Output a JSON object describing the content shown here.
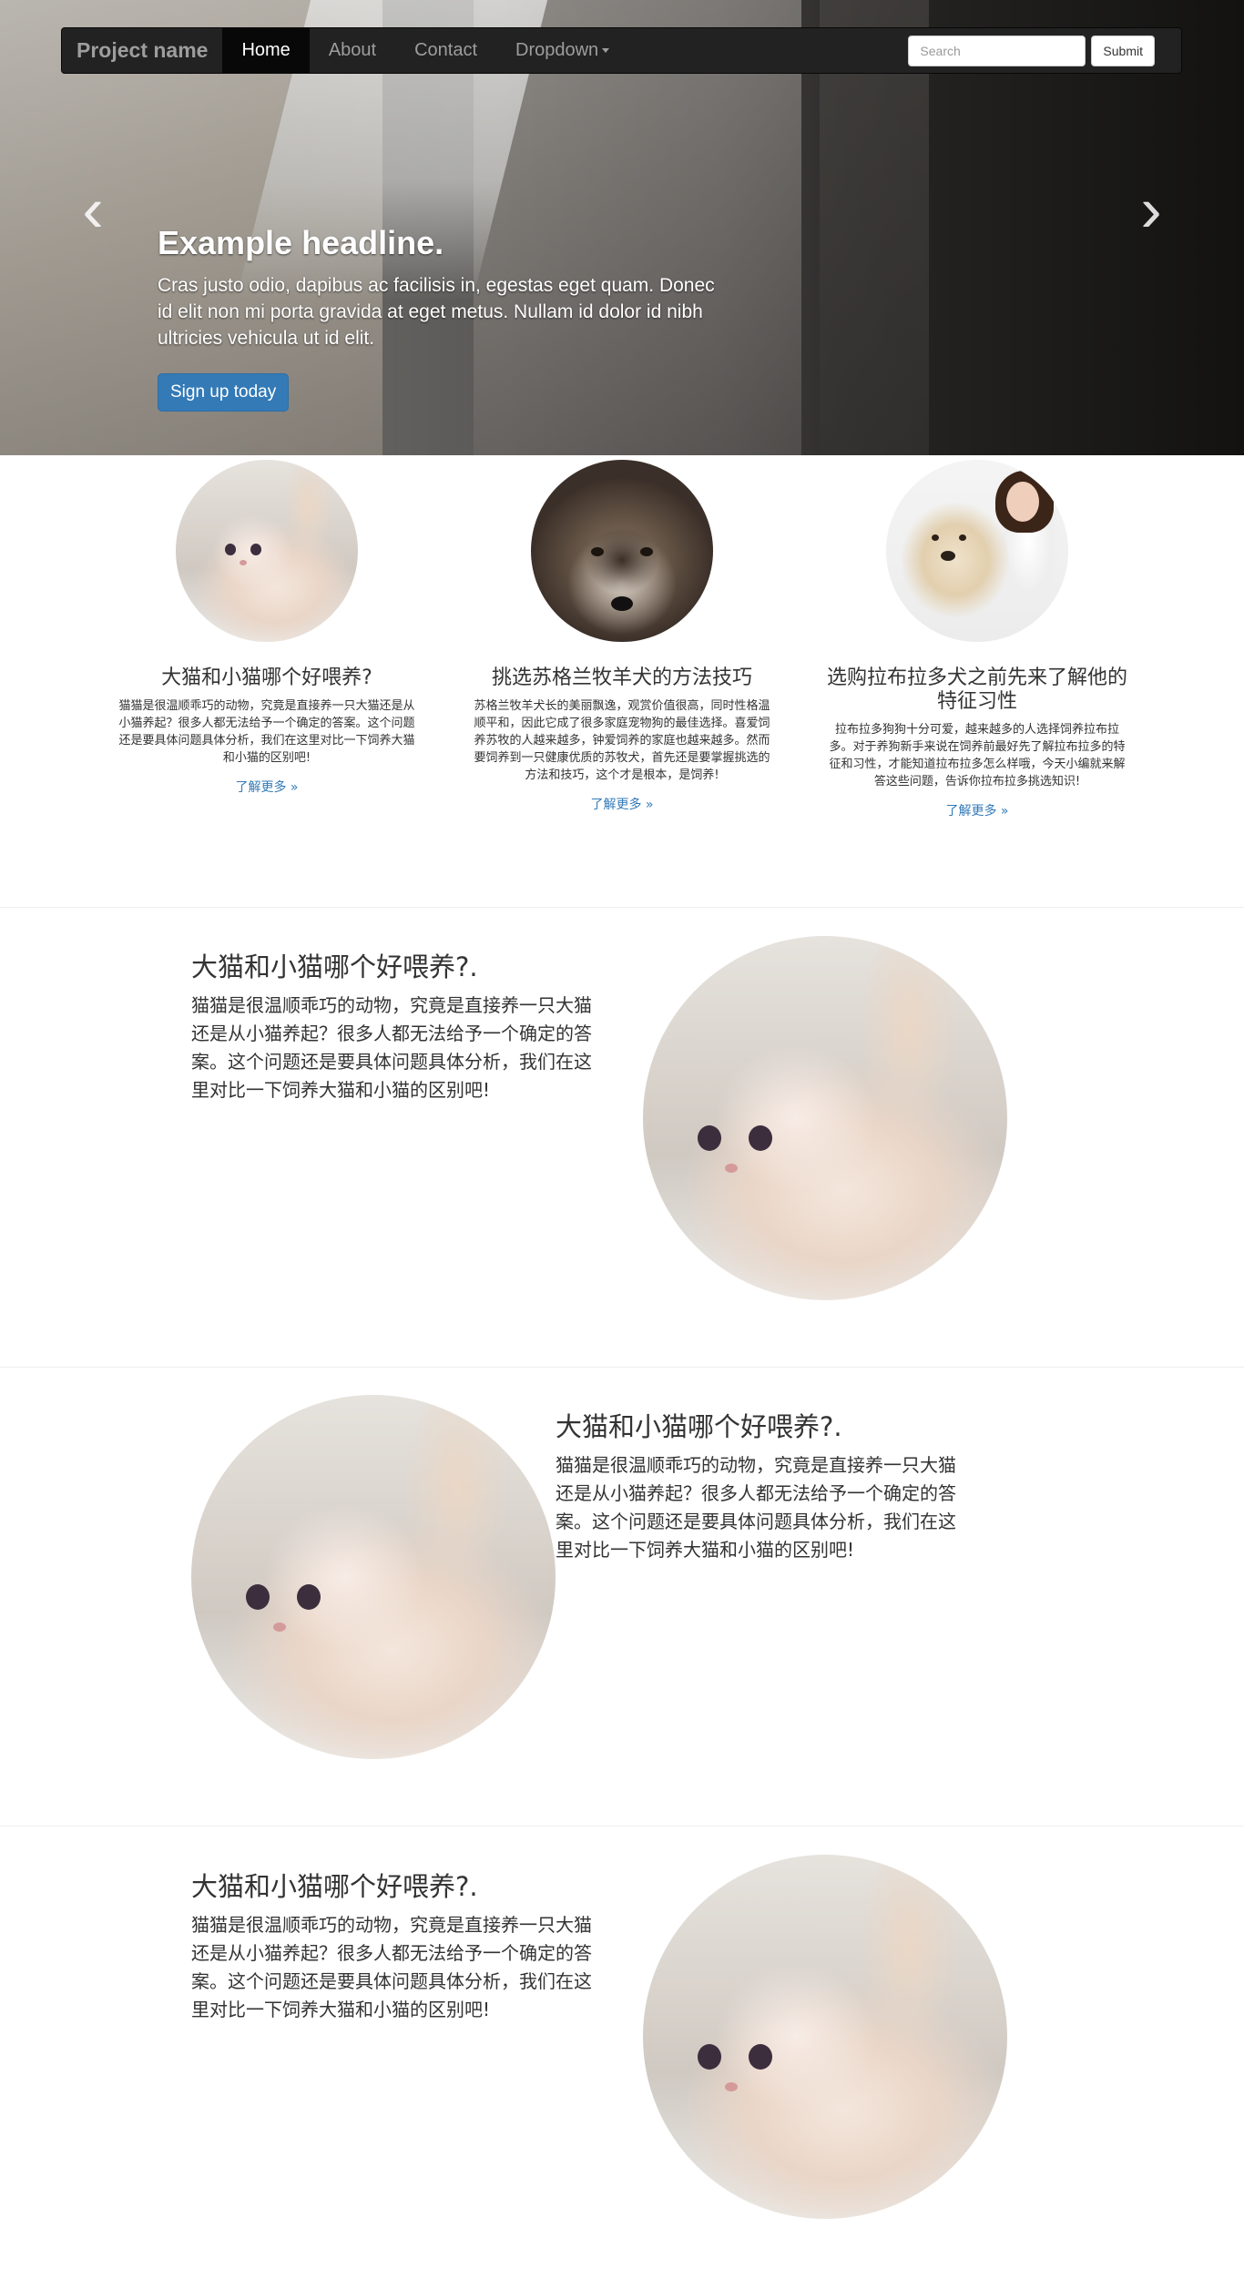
{
  "navbar": {
    "brand": "Project name",
    "items": [
      {
        "label": "Home",
        "active": true
      },
      {
        "label": "About",
        "active": false
      },
      {
        "label": "Contact",
        "active": false
      },
      {
        "label": "Dropdown",
        "active": false
      }
    ],
    "search_placeholder": "Search",
    "submit_label": "Submit"
  },
  "hero": {
    "headline": "Example headline.",
    "text": "Cras justo odio, dapibus ac facilisis in, egestas eget quam. Donec id elit non mi porta gravida at eget metus. Nullam id dolor id nibh ultricies vehicula ut id elit.",
    "button_label": "Sign up today",
    "prev_arrow": "‹",
    "next_arrow": "›"
  },
  "columns": [
    {
      "image": "kitten-photo",
      "heading": "大猫和小猫哪个好喂养?",
      "text": "猫猫是很温顺乖巧的动物，究竟是直接养一只大猫还是从小猫养起？很多人都无法给予一个确定的答案。这个问题还是要具体问题具体分析，我们在这里对比一下饲养大猫和小猫的区别吧!",
      "link": "了解更多 »"
    },
    {
      "image": "sheltie-dog-photo",
      "heading": "挑选苏格兰牧羊犬的方法技巧",
      "text": "苏格兰牧羊犬长的美丽飘逸，观赏价值很高，同时性格温顺平和，因此它成了很多家庭宠物狗的最佳选择。喜爱饲养苏牧的人越来越多，钟爱饲养的家庭也越来越多。然而要饲养到一只健康优质的苏牧犬，首先还是要掌握挑选的方法和技巧，这个才是根本，是饲养!",
      "link": "了解更多 »"
    },
    {
      "image": "labrador-vet-photo",
      "heading": "选购拉布拉多犬之前先来了解他的特征习性",
      "text": "拉布拉多狗狗十分可爱，越来越多的人选择饲养拉布拉多。对于养狗新手来说在饲养前最好先了解拉布拉多的特征和习性，才能知道拉布拉多怎么样哦，今天小编就来解答这些问题，告诉你拉布拉多挑选知识!",
      "link": "了解更多 »"
    }
  ],
  "featurettes": [
    {
      "heading": "大猫和小猫哪个好喂养?",
      "suffix": ".",
      "text": "猫猫是很温顺乖巧的动物，究竟是直接养一只大猫还是从小猫养起？很多人都无法给予一个确定的答案。这个问题还是要具体问题具体分析，我们在这里对比一下饲养大猫和小猫的区别吧!",
      "image": "kitten-photo"
    },
    {
      "heading": "大猫和小猫哪个好喂养?",
      "suffix": ".",
      "text": "猫猫是很温顺乖巧的动物，究竟是直接养一只大猫还是从小猫养起？很多人都无法给予一个确定的答案。这个问题还是要具体问题具体分析，我们在这里对比一下饲养大猫和小猫的区别吧!",
      "image": "kitten-photo"
    },
    {
      "heading": "大猫和小猫哪个好喂养?",
      "suffix": ".",
      "text": "猫猫是很温顺乖巧的动物，究竟是直接养一只大猫还是从小猫养起？很多人都无法给予一个确定的答案。这个问题还是要具体问题具体分析，我们在这里对比一下饲养大猫和小猫的区别吧!",
      "image": "kitten-photo"
    }
  ],
  "colors": {
    "navbar_bg": "#222222",
    "nav_active_bg": "#080808",
    "primary": "#337ab7",
    "link": "#337ab7"
  }
}
